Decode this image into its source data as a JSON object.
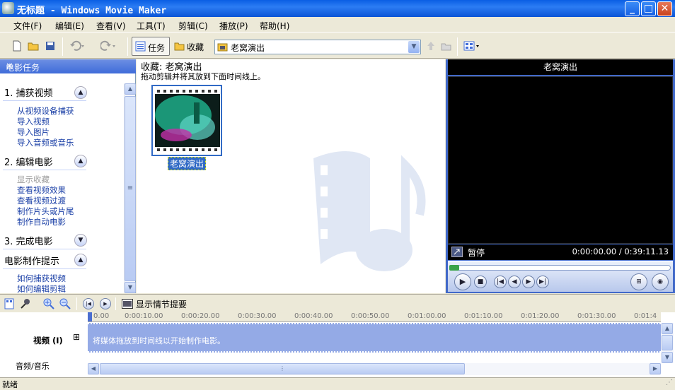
{
  "window": {
    "title": "无标题 - Windows Movie Maker",
    "minimize": "_",
    "maximize": "□",
    "close": "✕"
  },
  "menu": [
    "文件(F)",
    "编辑(E)",
    "查看(V)",
    "工具(T)",
    "剪辑(C)",
    "播放(P)",
    "帮助(H)"
  ],
  "toolbar": {
    "tasks_label": "任务",
    "collections_label": "收藏",
    "collection_value": "老窝演出"
  },
  "taskpane": {
    "title": "电影任务",
    "close": "✕",
    "sections": [
      {
        "title": "1. 捕获视频",
        "state": "expanded",
        "links": [
          "从视频设备捕获",
          "导入视频",
          "导入图片",
          "导入音频或音乐"
        ]
      },
      {
        "title": "2. 编辑电影",
        "state": "expanded",
        "links": [
          "显示收藏",
          "查看视频效果",
          "查看视频过渡",
          "制作片头或片尾",
          "制作自动电影"
        ]
      },
      {
        "title": "3. 完成电影",
        "state": "collapsed",
        "links": []
      },
      {
        "title": "电影制作提示",
        "state": "expanded",
        "links": [
          "如何捕获视频",
          "如何编辑剪辑"
        ]
      }
    ]
  },
  "collection": {
    "title": "收藏: 老窝演出",
    "hint": "拖动剪辑并将其放到下面时间线上。",
    "clip_label": "老窝演出"
  },
  "preview": {
    "title": "老窝演出",
    "status": "暂停",
    "time": "0:00:00.00 / 0:39:11.13",
    "seek_progress": 0.0
  },
  "timeline": {
    "show_storyboard": "显示情节提要",
    "ruler": [
      "0.00",
      "0:00:10.00",
      "0:00:20.00",
      "0:00:30.00",
      "0:00:40.00",
      "0:00:50.00",
      "0:01:00.00",
      "0:01:10.00",
      "0:01:20.00",
      "0:01:30.00",
      "0:01:4"
    ],
    "video_label": "视频 (I)",
    "audio_label": "音频/音乐",
    "video_hint": "将媒体拖放到时间线以开始制作电影。"
  },
  "status": {
    "text": "就绪"
  }
}
